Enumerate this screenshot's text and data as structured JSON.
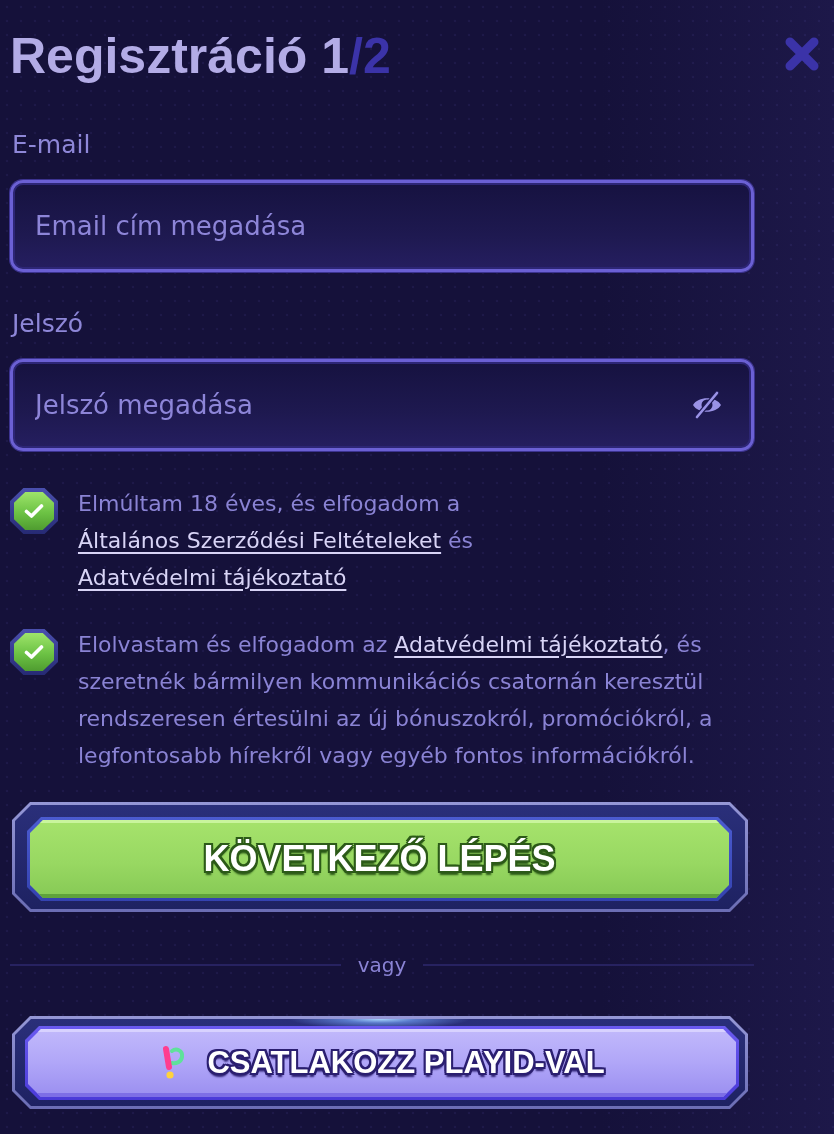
{
  "header": {
    "title": "Regisztráció 1",
    "step_total": "/2"
  },
  "fields": [
    {
      "kind": "email",
      "label": "E-mail",
      "placeholder": "Email cím megadása"
    },
    {
      "kind": "password",
      "label": "Jelszó",
      "placeholder": "Jelszó megadása"
    }
  ],
  "consents": [
    {
      "checked": true,
      "parts": [
        {
          "kind": "text",
          "text": "Elmúltam 18 éves, és elfogadom a "
        },
        {
          "kind": "link",
          "text": "Általános Szerződési Feltételeket"
        },
        {
          "kind": "text",
          "text": " és "
        },
        {
          "kind": "link",
          "text": "Adatvédelmi tájékoztató"
        }
      ]
    },
    {
      "checked": true,
      "parts": [
        {
          "kind": "text",
          "text": "Elolvastam és elfogadom az "
        },
        {
          "kind": "link",
          "text": "Adatvédelmi tájékoztató"
        },
        {
          "kind": "text",
          "text": ", és szeretnék bármilyen kommunikációs csatornán keresztül rendszeresen értesülni az új bónuszokról, promóciókról, a legfontosabb hírekről vagy egyéb fontos információkról."
        }
      ]
    }
  ],
  "next_button": {
    "label": "KÖVETKEZŐ LÉPÉS"
  },
  "divider": {
    "label": "vagy"
  },
  "playid_button": {
    "label": "CSATLAKOZZ PLAYID-VAL"
  }
}
